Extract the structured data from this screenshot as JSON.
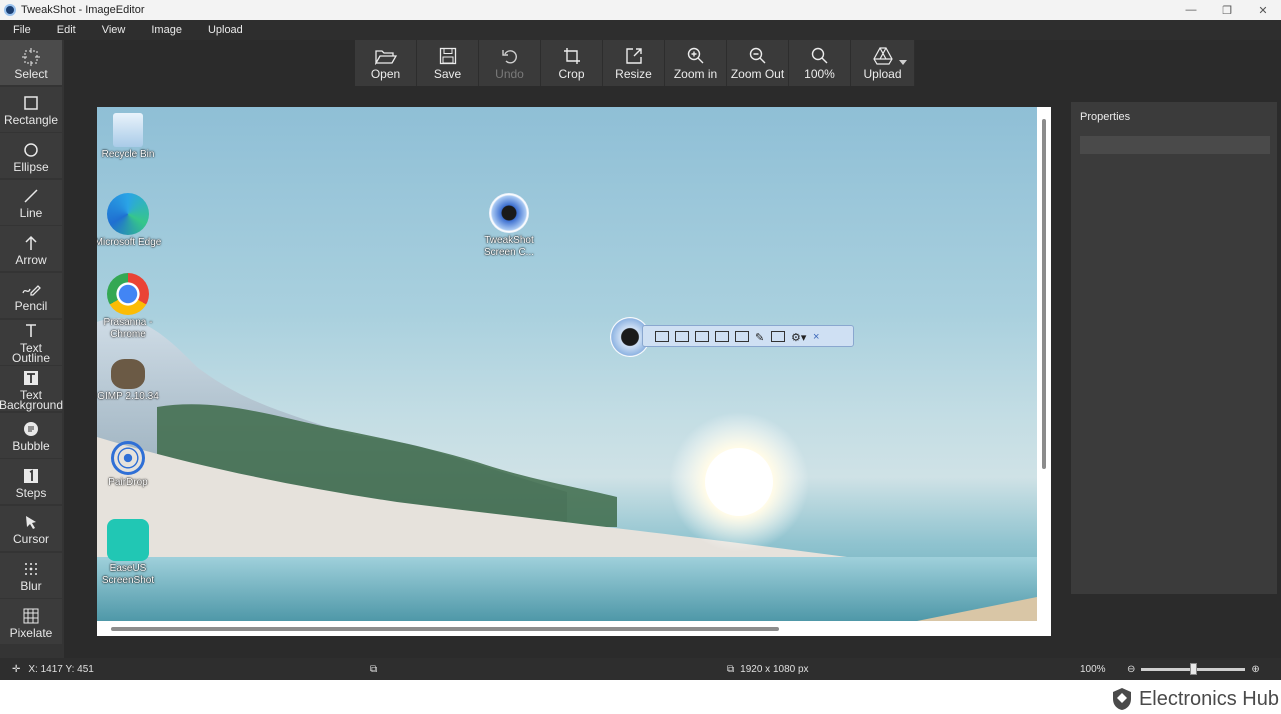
{
  "window": {
    "title": "TweakShot - ImageEditor",
    "min": "—",
    "max": "❐",
    "close": "✕"
  },
  "menu": [
    "File",
    "Edit",
    "View",
    "Image",
    "Upload"
  ],
  "tools": [
    {
      "label": "Select",
      "icon": "select-icon"
    },
    {
      "label": "Rectangle",
      "icon": "rectangle-icon"
    },
    {
      "label": "Ellipse",
      "icon": "ellipse-icon"
    },
    {
      "label": "Line",
      "icon": "line-icon"
    },
    {
      "label": "Arrow",
      "icon": "arrow-icon"
    },
    {
      "label": "Pencil",
      "icon": "pencil-icon"
    },
    {
      "label": "Text Outline",
      "icon": "text-outline-icon"
    },
    {
      "label": "Text Background",
      "icon": "text-background-icon"
    },
    {
      "label": "Bubble",
      "icon": "bubble-icon"
    },
    {
      "label": "Steps",
      "icon": "steps-icon"
    },
    {
      "label": "Cursor",
      "icon": "cursor-icon"
    },
    {
      "label": "Blur",
      "icon": "blur-icon"
    },
    {
      "label": "Pixelate",
      "icon": "pixelate-icon"
    }
  ],
  "toolbar": {
    "open": "Open",
    "save": "Save",
    "undo": "Undo",
    "crop": "Crop",
    "resize": "Resize",
    "zoom_in": "Zoom in",
    "zoom_out": "Zoom Out",
    "zoom_level": "100%",
    "upload": "Upload"
  },
  "desktop_icons": [
    {
      "label": "Recycle Bin"
    },
    {
      "label": "Microsoft Edge"
    },
    {
      "label": "Prasanna - Chrome"
    },
    {
      "label": "GIMP 2.10.34"
    },
    {
      "label": "PairDrop"
    },
    {
      "label": "EaseUS ScreenShot"
    },
    {
      "label": "TweakShot Screen C..."
    }
  ],
  "properties": {
    "title": "Properties"
  },
  "status": {
    "coords": "X: 1417 Y: 451",
    "size": "1920 x 1080 px",
    "zoom": "100%",
    "zoom_fraction": 0.5
  },
  "watermark": "Electronics Hub",
  "colors": {
    "bg_dark": "#2b2b2b",
    "panel": "#3b3b3b",
    "accent": "#4a78c4"
  }
}
